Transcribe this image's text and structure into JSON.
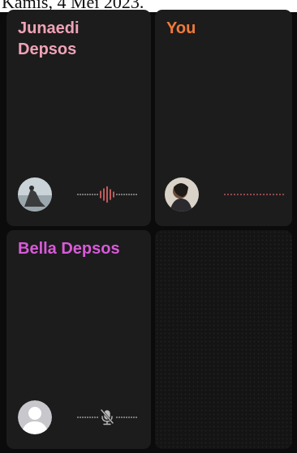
{
  "caption": "Kamis, 4 Mei 2023.",
  "colors": {
    "tile_background": "#1c1c1d",
    "name_junaedi": "#f0a3b6",
    "name_you": "#f07a3a",
    "name_bella": "#d85ad8",
    "audio_dots": "#bbbbbb",
    "audio_active": "#e86a6a"
  },
  "tiles": [
    {
      "name": "Junaedi Depsos",
      "avatar": "profile-photo-landscape",
      "audio_state": "speaking"
    },
    {
      "name": "You",
      "avatar": "profile-photo-person",
      "audio_state": "idle"
    },
    {
      "name": "Bella Depsos",
      "avatar": "default-avatar-icon",
      "audio_state": "muted"
    },
    {
      "name": "",
      "avatar": "",
      "audio_state": "empty"
    }
  ]
}
